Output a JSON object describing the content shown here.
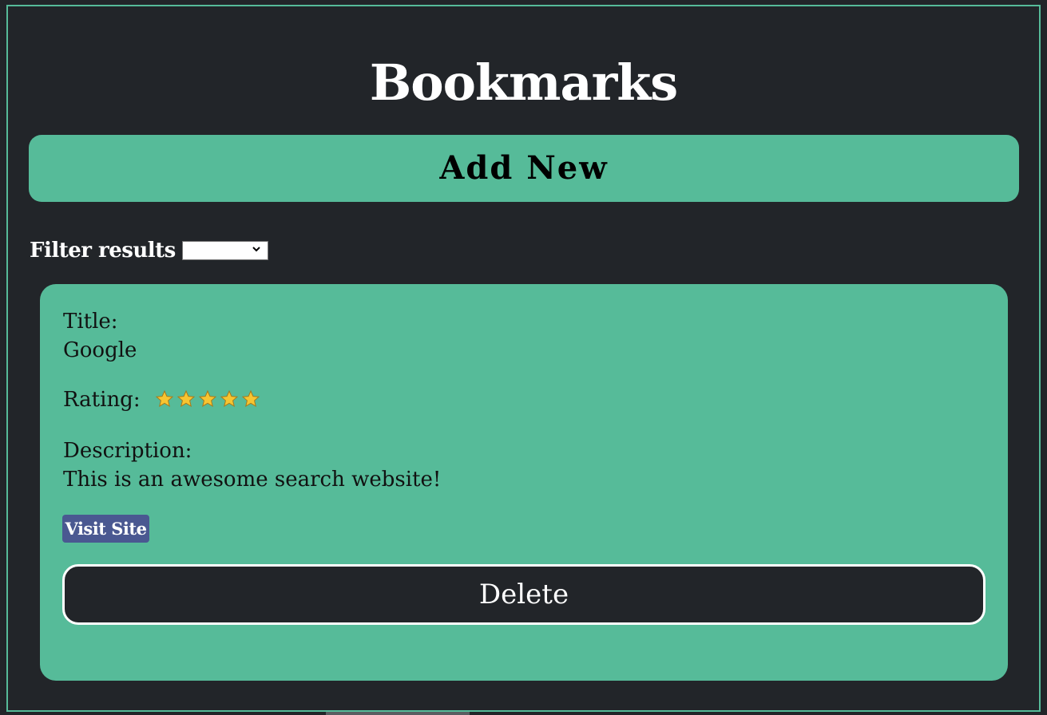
{
  "header": {
    "title": "Bookmarks"
  },
  "actions": {
    "add_label": "Add New"
  },
  "filter": {
    "label": "Filter results",
    "selected_value": ""
  },
  "bookmark": {
    "title_label": "Title:",
    "title": "Google",
    "rating_label": "Rating:",
    "rating": 5,
    "rating_max": 5,
    "description_label": "Description:",
    "description": "This is an awesome search website!",
    "visit_label": "Visit Site",
    "delete_label": "Delete"
  },
  "colors": {
    "background": "#222529",
    "accent": "#56bb99",
    "visit_button": "#4a5891",
    "star": "#f7c531"
  },
  "icons": {
    "rating_star": "star-icon",
    "select_arrow": "chevron-down-icon"
  }
}
